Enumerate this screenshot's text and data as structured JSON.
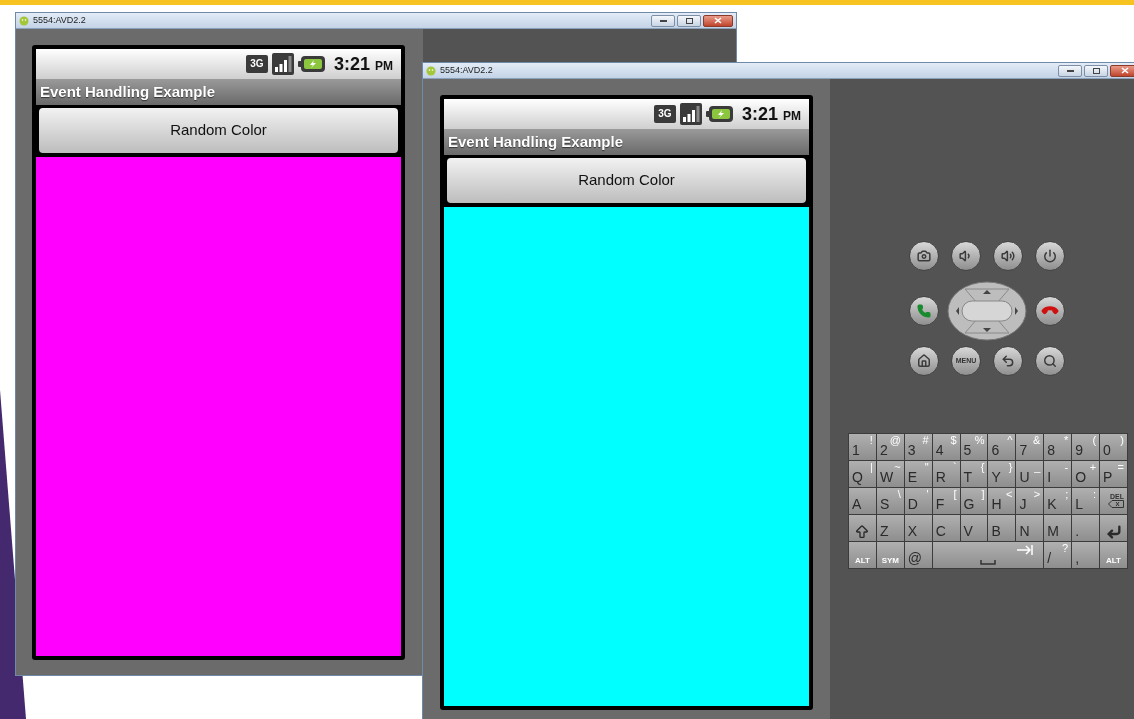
{
  "windows": [
    {
      "title": "5554:AVD2.2",
      "screen": {
        "network": "3G",
        "time": "3:21",
        "meridiem": "PM",
        "app_title": "Event Handling Example",
        "button_label": "Random Color",
        "color": "#ff00ff"
      }
    },
    {
      "title": "5554:AVD2.2",
      "screen": {
        "network": "3G",
        "time": "3:21",
        "meridiem": "PM",
        "app_title": "Event Handling Example",
        "button_label": "Random Color",
        "color": "#00ffff"
      },
      "hardware_buttons": [
        [
          {
            "kind": "camera"
          },
          {
            "kind": "volume_down"
          },
          {
            "kind": "volume_up"
          },
          {
            "kind": "power"
          }
        ],
        [
          {
            "kind": "call"
          },
          {
            "kind": "dpad"
          },
          {
            "kind": "end_call"
          }
        ],
        [
          {
            "kind": "home"
          },
          {
            "kind": "menu",
            "label": "MENU"
          },
          {
            "kind": "back"
          },
          {
            "kind": "search"
          }
        ]
      ],
      "keyboard": [
        [
          {
            "kind": "char",
            "label": "1",
            "alt": "!"
          },
          {
            "kind": "char",
            "label": "2",
            "alt": "@"
          },
          {
            "kind": "char",
            "label": "3",
            "alt": "#"
          },
          {
            "kind": "char",
            "label": "4",
            "alt": "$"
          },
          {
            "kind": "char",
            "label": "5",
            "alt": "%"
          },
          {
            "kind": "char",
            "label": "6",
            "alt": "^"
          },
          {
            "kind": "char",
            "label": "7",
            "alt": "&"
          },
          {
            "kind": "char",
            "label": "8",
            "alt": "*"
          },
          {
            "kind": "char",
            "label": "9",
            "alt": "("
          },
          {
            "kind": "char",
            "label": "0",
            "alt": ")"
          }
        ],
        [
          {
            "kind": "char",
            "label": "Q",
            "alt": "|"
          },
          {
            "kind": "char",
            "label": "W",
            "alt": "~"
          },
          {
            "kind": "char",
            "label": "E",
            "alt": "\""
          },
          {
            "kind": "char",
            "label": "R",
            "alt": "`"
          },
          {
            "kind": "char",
            "label": "T",
            "alt": "{"
          },
          {
            "kind": "char",
            "label": "Y",
            "alt": "}"
          },
          {
            "kind": "char",
            "label": "U",
            "alt": "_"
          },
          {
            "kind": "char",
            "label": "I",
            "alt": "-"
          },
          {
            "kind": "char",
            "label": "O",
            "alt": "+"
          },
          {
            "kind": "char",
            "label": "P",
            "alt": "="
          }
        ],
        [
          {
            "kind": "char",
            "label": "A"
          },
          {
            "kind": "char",
            "label": "S",
            "alt": "\\"
          },
          {
            "kind": "char",
            "label": "D",
            "alt": "'"
          },
          {
            "kind": "char",
            "label": "F",
            "alt": "["
          },
          {
            "kind": "char",
            "label": "G",
            "alt": "]"
          },
          {
            "kind": "char",
            "label": "H",
            "alt": "<"
          },
          {
            "kind": "char",
            "label": "J",
            "alt": ">"
          },
          {
            "kind": "char",
            "label": "K",
            "alt": ";"
          },
          {
            "kind": "char",
            "label": "L",
            "alt": ":"
          },
          {
            "kind": "del",
            "label": "DEL"
          }
        ],
        [
          {
            "kind": "shift"
          },
          {
            "kind": "char",
            "label": "Z"
          },
          {
            "kind": "char",
            "label": "X"
          },
          {
            "kind": "char",
            "label": "C"
          },
          {
            "kind": "char",
            "label": "V"
          },
          {
            "kind": "char",
            "label": "B"
          },
          {
            "kind": "char",
            "label": "N"
          },
          {
            "kind": "char",
            "label": "M"
          },
          {
            "kind": "char",
            "label": "."
          },
          {
            "kind": "enter"
          }
        ],
        [
          {
            "kind": "mod",
            "label": "ALT"
          },
          {
            "kind": "mod",
            "label": "SYM"
          },
          {
            "kind": "char",
            "label": "@"
          },
          {
            "kind": "space"
          },
          {
            "kind": "char",
            "label": "/",
            "alt": "?"
          },
          {
            "kind": "char",
            "label": ","
          },
          {
            "kind": "mod",
            "label": "ALT"
          }
        ]
      ]
    }
  ]
}
